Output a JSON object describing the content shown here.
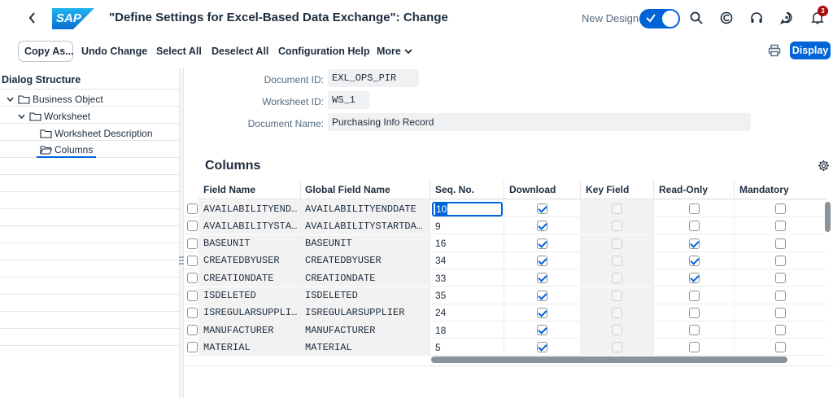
{
  "shell": {
    "title": "\"Define Settings for Excel-Based Data Exchange\": Change",
    "new_design_label": "New Design",
    "notification_count": "3",
    "logo_text": "SAP",
    "icons": [
      "back-icon",
      "search-icon",
      "copilot-icon",
      "headset-icon",
      "feedback-icon",
      "bell-icon"
    ]
  },
  "toolbar": {
    "copy_as": "Copy As...",
    "undo_change": "Undo Change",
    "select_all": "Select All",
    "deselect_all": "Deselect All",
    "configuration_help": "Configuration Help",
    "more": "More",
    "display": "Display"
  },
  "dialog_structure": {
    "header": "Dialog Structure",
    "items": [
      {
        "label": "Business Object"
      },
      {
        "label": "Worksheet"
      },
      {
        "label": "Worksheet Description"
      },
      {
        "label": "Columns"
      }
    ]
  },
  "form": {
    "document_id_label": "Document ID:",
    "document_id": "EXL_OPS_PIR",
    "worksheet_id_label": "Worksheet ID:",
    "worksheet_id": "WS_1",
    "document_name_label": "Document Name:",
    "document_name": "Purchasing Info Record"
  },
  "columns": {
    "title": "Columns",
    "headers": [
      "Field Name",
      "Global Field Name",
      "Seq. No.",
      "Download",
      "Key Field",
      "Read-Only",
      "Mandatory"
    ],
    "rows": [
      {
        "field": "AVAILABILITYEND…",
        "global": "AVAILABILITYENDDATE",
        "seq": "10",
        "download": true,
        "key": false,
        "readonly": false,
        "mandatory": false
      },
      {
        "field": "AVAILABILITYSTA…",
        "global": "AVAILABILITYSTARTDA…",
        "seq": "9",
        "download": true,
        "key": false,
        "readonly": false,
        "mandatory": false
      },
      {
        "field": "BASEUNIT",
        "global": "BASEUNIT",
        "seq": "16",
        "download": true,
        "key": false,
        "readonly": true,
        "mandatory": false
      },
      {
        "field": "CREATEDBYUSER",
        "global": "CREATEDBYUSER",
        "seq": "34",
        "download": true,
        "key": false,
        "readonly": true,
        "mandatory": false
      },
      {
        "field": "CREATIONDATE",
        "global": "CREATIONDATE",
        "seq": "33",
        "download": true,
        "key": false,
        "readonly": true,
        "mandatory": false
      },
      {
        "field": "ISDELETED",
        "global": "ISDELETED",
        "seq": "35",
        "download": true,
        "key": false,
        "readonly": false,
        "mandatory": false
      },
      {
        "field": "ISREGULARSUPPLI…",
        "global": "ISREGULARSUPPLIER",
        "seq": "24",
        "download": true,
        "key": false,
        "readonly": false,
        "mandatory": false
      },
      {
        "field": "MANUFACTURER",
        "global": "MANUFACTURER",
        "seq": "18",
        "download": true,
        "key": false,
        "readonly": false,
        "mandatory": false
      },
      {
        "field": "MATERIAL",
        "global": "MATERIAL",
        "seq": "5",
        "download": true,
        "key": false,
        "readonly": false,
        "mandatory": false
      }
    ]
  },
  "colors": {
    "accent": "#0064d9",
    "text": "#1d2d3e",
    "muted": "#556b82",
    "field_bg": "#eff1f2"
  }
}
